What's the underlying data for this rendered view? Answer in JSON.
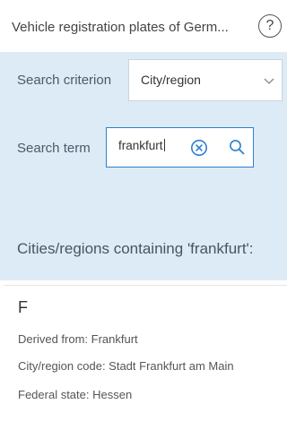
{
  "header": {
    "title": "Vehicle registration plates of Germ...",
    "help_label": "?"
  },
  "search": {
    "criterion_label": "Search criterion",
    "criterion_value": "City/region",
    "term_label": "Search term",
    "term_value": "frankfurt",
    "results_heading": "Cities/regions containing 'frankfurt':"
  },
  "result": {
    "code": "F",
    "derived_from": "Derived from: Frankfurt",
    "city_region_code": "City/region code: Stadt Frankfurt am Main",
    "federal_state": "Federal state: Hessen"
  },
  "colors": {
    "panel_background": "#dcebf6",
    "accent": "#2f7fd0"
  },
  "icons": [
    "help-icon",
    "chevron-down-icon",
    "clear-icon",
    "search-icon"
  ]
}
